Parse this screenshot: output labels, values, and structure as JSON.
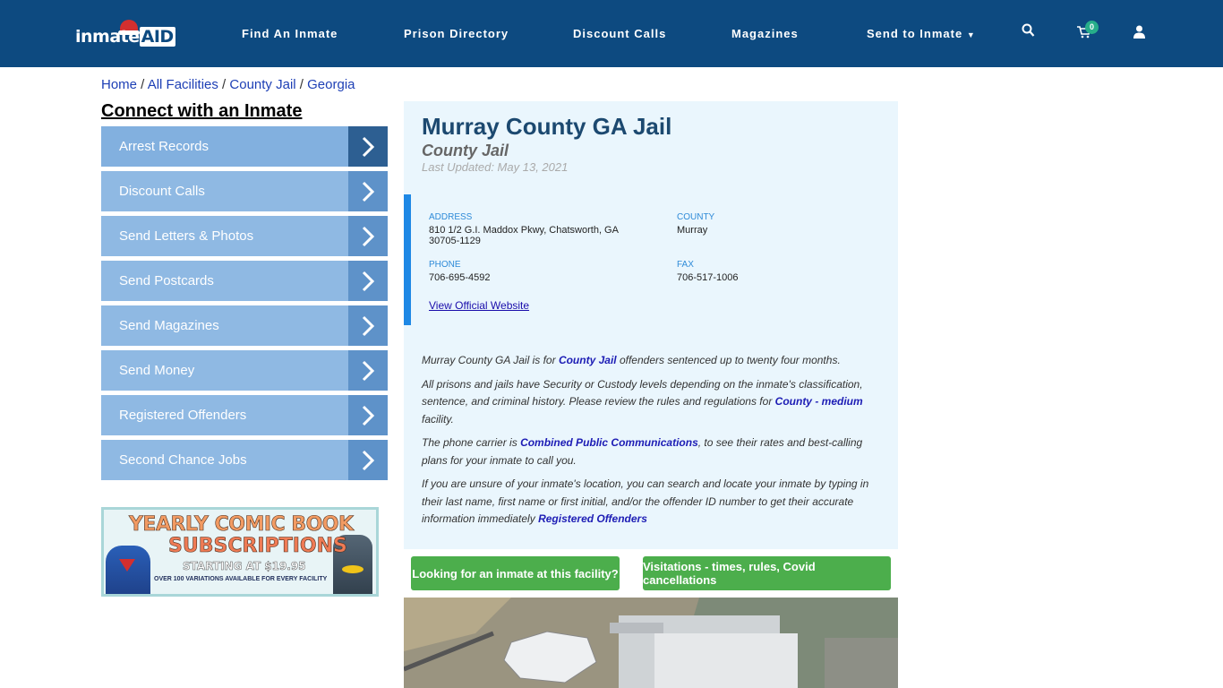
{
  "header": {
    "logo_text": "inmate",
    "logo_accent": "AID",
    "nav": [
      "Find An Inmate",
      "Prison Directory",
      "Discount Calls",
      "Magazines",
      "Send to Inmate"
    ],
    "cart_count": "0",
    "icons": [
      "search-icon",
      "cart-icon",
      "user-icon"
    ]
  },
  "breadcrumb": [
    "Home",
    "All Facilities",
    "County Jail",
    "Georgia"
  ],
  "sidebar": {
    "heading": "Connect with an Inmate",
    "items": [
      "Arrest Records",
      "Discount Calls",
      "Send Letters & Photos",
      "Send Postcards",
      "Send Magazines",
      "Send Money",
      "Registered Offenders",
      "Second Chance Jobs"
    ]
  },
  "ad": {
    "line1": "YEARLY COMIC BOOK",
    "line2": "SUBSCRIPTIONS",
    "line3": "STARTING AT $19.95",
    "line4": "OVER 100 VARIATIONS AVAILABLE FOR EVERY FACILITY"
  },
  "facility": {
    "title": "Murray County GA Jail",
    "type": "County Jail",
    "updated": "Last Updated: May 13, 2021",
    "address_label": "ADDRESS",
    "address_line1": "810 1/2 G.I. Maddox Pkwy, Chatsworth, GA",
    "address_line2": "30705-1129",
    "county_label": "COUNTY",
    "county": "Murray",
    "phone_label": "PHONE",
    "phone": "706-695-4592",
    "fax_label": "FAX",
    "fax": "706-517-1006",
    "website_link": "View Official Website"
  },
  "description": {
    "p1_a": "Murray County GA Jail is for ",
    "p1_link": "County Jail",
    "p1_b": " offenders sentenced up to twenty four months.",
    "p2_a": "All prisons and jails have Security or Custody levels depending on the inmate's classification, sentence, and criminal history. Please review the rules and regulations for ",
    "p2_link": "County - medium",
    "p2_b": " facility.",
    "p3_a": "The phone carrier is ",
    "p3_link": "Combined Public Communications",
    "p3_b": ", to see their rates and best-calling plans for your inmate to call you.",
    "p4_a": "If you are unsure of your inmate's location, you can search and locate your inmate by typing in their last name, first name or first initial, and/or the offender ID number to get their accurate information immediately ",
    "p4_link": "Registered Offenders"
  },
  "buttons": {
    "looking": "Looking for an inmate at this facility?",
    "visitations": "Visitations - times, rules, Covid cancellations"
  }
}
